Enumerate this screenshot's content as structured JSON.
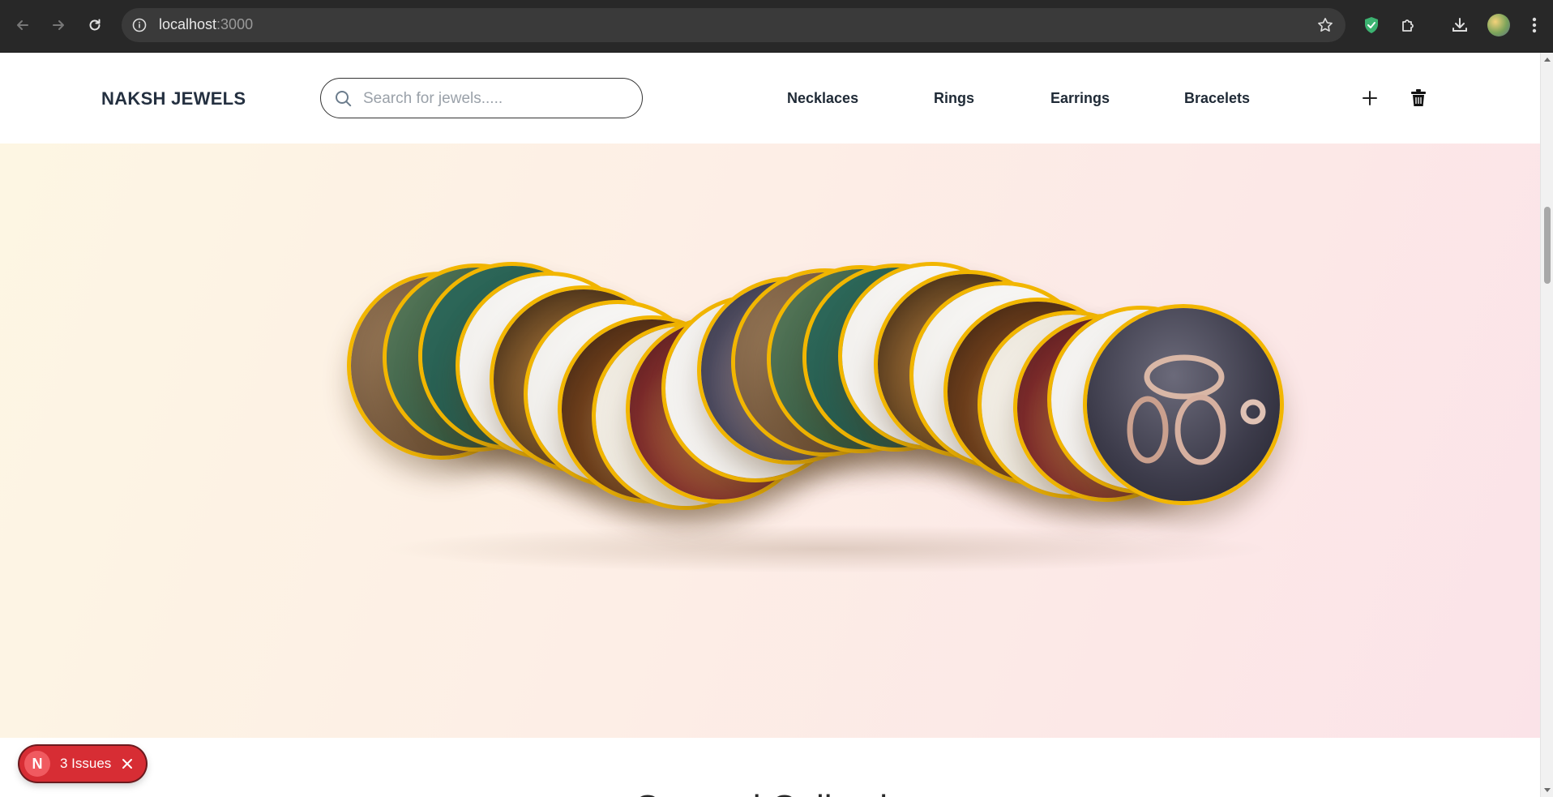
{
  "browser": {
    "url_host": "localhost",
    "url_port": ":3000",
    "icons": [
      "back-icon",
      "forward-icon",
      "reload-icon",
      "site-info-icon",
      "bookmark-star-icon",
      "shield-extension-icon",
      "extensions-puzzle-icon",
      "download-icon",
      "profile-avatar",
      "more-menu-icon"
    ]
  },
  "header": {
    "brand": "NAKSH JEWELS",
    "search_placeholder": "Search for jewels.....",
    "nav": [
      "Necklaces",
      "Rings",
      "Earrings",
      "Bracelets"
    ],
    "icons": [
      "add-icon",
      "trash-icon"
    ]
  },
  "hero": {
    "carousel_items": 16,
    "accent_color": "#f2b600"
  },
  "section": {
    "title": "Curated Collection"
  },
  "dev_overlay": {
    "logo_letter": "N",
    "label": "3 Issues"
  }
}
